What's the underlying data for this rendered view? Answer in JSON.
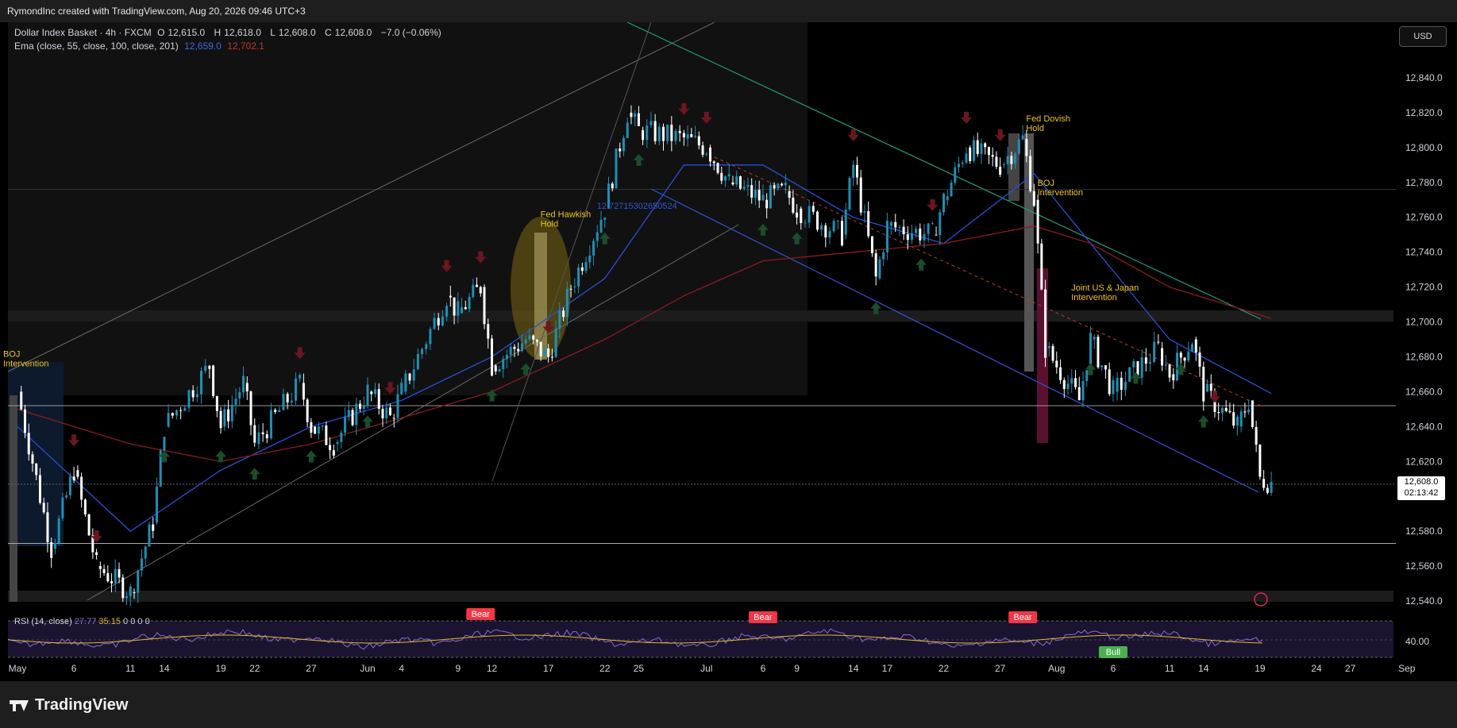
{
  "header": {
    "credit": "RymondInc created with TradingView.com, Aug 20, 2026 09:46 UTC+3"
  },
  "legend": {
    "symbol": "Dollar Index Basket · 4h · FXCM",
    "ohlc": [
      {
        "label": "O",
        "value": "12,615.0"
      },
      {
        "label": "H",
        "value": "12,618.0"
      },
      {
        "label": "L",
        "value": "12,608.0"
      },
      {
        "label": "C",
        "value": "12,608.0"
      }
    ],
    "change": "−7.0 (−0.06%)",
    "ema_label": "Ema (close, 55, close, 100, close, 201)",
    "ema_values": [
      "12,659.0",
      "12,702.1"
    ]
  },
  "currency_button": "USD",
  "price_tag": {
    "price": "12,608.0",
    "countdown": "02:13:42"
  },
  "rsi_legend": {
    "label": "RSI (14, close)",
    "values": [
      "27.77",
      "35.15",
      "0",
      "0",
      "0",
      "0"
    ]
  },
  "footer": {
    "brand": "TradingView"
  },
  "colors": {
    "bull_candle": "#1e90b4",
    "bear_candle": "#ffffff",
    "ema55": "#2a4fd6",
    "ema100": "#8b1c1c",
    "annotation": "#f0c419",
    "channel_lines": "#6a6a6a",
    "down_trend_blue": "#2f56d8",
    "down_trend_green": "#1f9e7a",
    "rsi_line": "#8a6bd1",
    "rsi_signal": "#e0b830",
    "bear_label": "#f23645",
    "bull_label": "#4caf50",
    "up_arrow": "#1b4d2b",
    "down_arrow": "#6b1620"
  },
  "chart_data": {
    "type": "line",
    "title": "Dollar Index Basket · 4h · FXCM",
    "y_axis": {
      "range": [
        12525,
        12850
      ],
      "ticks": [
        "12,840.0",
        "12,820.0",
        "12,800.0",
        "12,780.0",
        "12,760.0",
        "12,740.0",
        "12,720.0",
        "12,700.0",
        "12,680.0",
        "12,660.0",
        "12,640.0",
        "12,620.0",
        "12,580.0",
        "12,560.0",
        "12,540.0"
      ]
    },
    "x_axis": {
      "ticks": [
        "May",
        "6",
        "11",
        "14",
        "19",
        "22",
        "27",
        "Jun",
        "4",
        "9",
        "12",
        "17",
        "22",
        "25",
        "Jul",
        "6",
        "9",
        "14",
        "17",
        "22",
        "27",
        "Aug",
        "6",
        "11",
        "14",
        "19",
        "24",
        "27",
        "Sep"
      ]
    },
    "series": [
      {
        "name": "Dollar Index Basket",
        "x": [
          "May 1",
          "May 4",
          "May 6",
          "May 8",
          "May 11",
          "May 13",
          "May 14",
          "May 18",
          "May 19",
          "May 21",
          "May 22",
          "May 26",
          "May 27",
          "May 29",
          "Jun 1",
          "Jun 3",
          "Jun 4",
          "Jun 8",
          "Jun 9",
          "Jun 11",
          "Jun 12",
          "Jun 15",
          "Jun 17",
          "Jun 19",
          "Jun 22",
          "Jun 24",
          "Jun 25",
          "Jun 29",
          "Jul 1",
          "Jul 3",
          "Jul 6",
          "Jul 8",
          "Jul 9",
          "Jul 13",
          "Jul 14",
          "Jul 16",
          "Jul 17",
          "Jul 21",
          "Jul 22",
          "Jul 24",
          "Jul 27",
          "Jul 29",
          "Jul 30",
          "Jul 31",
          "Aug 3",
          "Aug 4",
          "Aug 6",
          "Aug 10",
          "Aug 11",
          "Aug 13",
          "Aug 14",
          "Aug 17",
          "Aug 18",
          "Aug 19",
          "Aug 20"
        ],
        "values": [
          12660,
          12570,
          12615,
          12560,
          12545,
          12585,
          12640,
          12675,
          12640,
          12665,
          12630,
          12665,
          12640,
          12630,
          12660,
          12645,
          12660,
          12715,
          12705,
          12720,
          12675,
          12690,
          12680,
          12720,
          12765,
          12820,
          12810,
          12805,
          12800,
          12780,
          12770,
          12775,
          12765,
          12750,
          12790,
          12725,
          12755,
          12750,
          12770,
          12800,
          12790,
          12805,
          12770,
          12685,
          12655,
          12690,
          12660,
          12685,
          12670,
          12690,
          12660,
          12640,
          12655,
          12610,
          12608
        ]
      },
      {
        "name": "Ema 55",
        "x": [
          "May 1",
          "May 11",
          "May 19",
          "May 27",
          "Jun 4",
          "Jun 12",
          "Jun 22",
          "Jun 29",
          "Jul 6",
          "Jul 14",
          "Jul 22",
          "Jul 30",
          "Aug 4",
          "Aug 11",
          "Aug 20"
        ],
        "values": [
          12640,
          12580,
          12615,
          12640,
          12655,
          12680,
          12725,
          12790,
          12790,
          12760,
          12745,
          12785,
          12745,
          12690,
          12659
        ]
      },
      {
        "name": "Ema 100",
        "x": [
          "May 1",
          "May 11",
          "May 19",
          "May 27",
          "Jun 4",
          "Jun 12",
          "Jun 22",
          "Jun 29",
          "Jul 6",
          "Jul 14",
          "Jul 22",
          "Jul 30",
          "Aug 4",
          "Aug 11",
          "Aug 20"
        ],
        "values": [
          12650,
          12630,
          12620,
          12630,
          12645,
          12660,
          12690,
          12715,
          12735,
          12740,
          12745,
          12755,
          12745,
          12720,
          12702
        ]
      }
    ],
    "annotations": [
      {
        "text": "BOJ\nIntervention",
        "x": "May 1",
        "y": 12680
      },
      {
        "text": "Fed Hawkish\nHold",
        "x": "Jun 17",
        "y": 12760
      },
      {
        "text": "Fed Dovish\nHold",
        "x": "Jul 30",
        "y": 12815
      },
      {
        "text": "BOJ\nIntervention",
        "x": "Jul 31",
        "y": 12778
      },
      {
        "text": "Joint US & Japan\nIntervention",
        "x": "Aug 3",
        "y": 12718
      },
      {
        "text": "12.72715302650524",
        "x": "Jun 22",
        "y": 12765
      }
    ],
    "rsi": {
      "label": "RSI (14, close)",
      "tick": "40.00",
      "divergence_labels": [
        {
          "text": "Bear",
          "x": "Jun 11"
        },
        {
          "text": "Bear",
          "x": "Jul 6"
        },
        {
          "text": "Bear",
          "x": "Jul 29"
        },
        {
          "text": "Bull",
          "x": "Aug 6"
        }
      ]
    },
    "grid": false,
    "legend_position": "top-left"
  }
}
